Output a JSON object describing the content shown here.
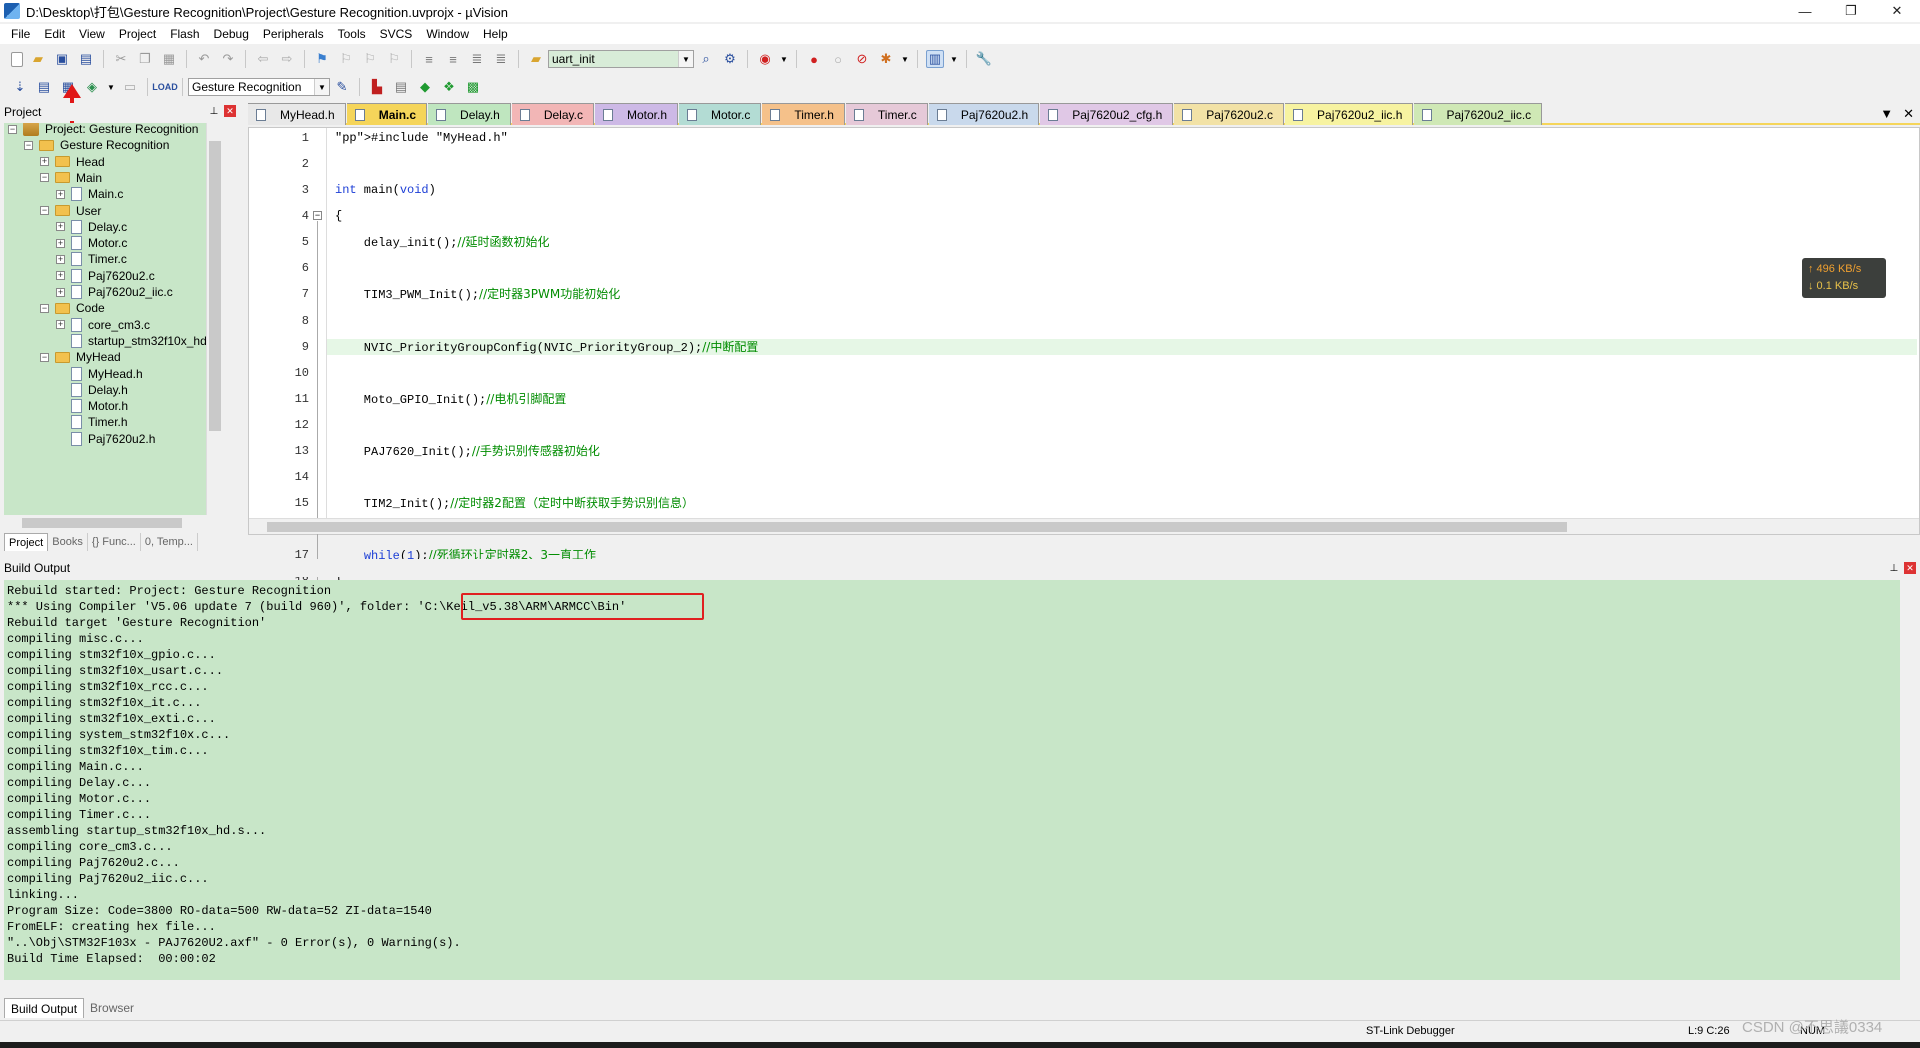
{
  "window": {
    "title": "D:\\Desktop\\打包\\Gesture Recognition\\Project\\Gesture Recognition.uvprojx - µVision",
    "controls": {
      "minimize": "—",
      "maximize": "❐",
      "close": "✕"
    }
  },
  "menu": [
    "File",
    "Edit",
    "View",
    "Project",
    "Flash",
    "Debug",
    "Peripherals",
    "Tools",
    "SVCS",
    "Window",
    "Help"
  ],
  "toolbar": {
    "find_combo": "uart_init",
    "target_combo": "Gesture Recognition"
  },
  "project_panel": {
    "title": "Project",
    "tree": [
      {
        "label": "Project: Gesture Recognition",
        "level": 0,
        "kind": "project",
        "expander": "−"
      },
      {
        "label": "Gesture Recognition",
        "level": 1,
        "kind": "target",
        "expander": "−"
      },
      {
        "label": "Head",
        "level": 2,
        "kind": "folder",
        "expander": "+"
      },
      {
        "label": "Main",
        "level": 2,
        "kind": "folder",
        "expander": "−"
      },
      {
        "label": "Main.c",
        "level": 3,
        "kind": "file",
        "expander": "+"
      },
      {
        "label": "User",
        "level": 2,
        "kind": "folder",
        "expander": "−"
      },
      {
        "label": "Delay.c",
        "level": 3,
        "kind": "file",
        "expander": "+"
      },
      {
        "label": "Motor.c",
        "level": 3,
        "kind": "file",
        "expander": "+"
      },
      {
        "label": "Timer.c",
        "level": 3,
        "kind": "file",
        "expander": "+"
      },
      {
        "label": "Paj7620u2.c",
        "level": 3,
        "kind": "file",
        "expander": "+"
      },
      {
        "label": "Paj7620u2_iic.c",
        "level": 3,
        "kind": "file",
        "expander": "+"
      },
      {
        "label": "Code",
        "level": 2,
        "kind": "folder",
        "expander": "−"
      },
      {
        "label": "core_cm3.c",
        "level": 3,
        "kind": "file",
        "expander": "+"
      },
      {
        "label": "startup_stm32f10x_hd",
        "level": 3,
        "kind": "file",
        "expander": ""
      },
      {
        "label": "MyHead",
        "level": 2,
        "kind": "folder",
        "expander": "−"
      },
      {
        "label": "MyHead.h",
        "level": 3,
        "kind": "file",
        "expander": ""
      },
      {
        "label": "Delay.h",
        "level": 3,
        "kind": "file",
        "expander": ""
      },
      {
        "label": "Motor.h",
        "level": 3,
        "kind": "file",
        "expander": ""
      },
      {
        "label": "Timer.h",
        "level": 3,
        "kind": "file",
        "expander": ""
      },
      {
        "label": "Paj7620u2.h",
        "level": 3,
        "kind": "file",
        "expander": ""
      }
    ],
    "tabs": [
      "Project",
      "Books",
      "{} Func...",
      "0, Temp..."
    ]
  },
  "editor": {
    "tabs": [
      {
        "label": "MyHead.h",
        "color": "#e8e8e8",
        "active": false
      },
      {
        "label": "Main.c",
        "color": "#f5d55a",
        "active": true
      },
      {
        "label": "Delay.h",
        "color": "#bfe6bf",
        "active": false
      },
      {
        "label": "Delay.c",
        "color": "#f2b6b6",
        "active": false
      },
      {
        "label": "Motor.h",
        "color": "#cdb9e6",
        "active": false
      },
      {
        "label": "Motor.c",
        "color": "#b3dcd4",
        "active": false
      },
      {
        "label": "Timer.h",
        "color": "#f5c18a",
        "active": false
      },
      {
        "label": "Timer.c",
        "color": "#e6c9d8",
        "active": false
      },
      {
        "label": "Paj7620u2.h",
        "color": "#c9d9ec",
        "active": false
      },
      {
        "label": "Paj7620u2_cfg.h",
        "color": "#e0c8e6",
        "active": false
      },
      {
        "label": "Paj7620u2.c",
        "color": "#f2e2a6",
        "active": false
      },
      {
        "label": "Paj7620u2_iic.h",
        "color": "#f7f3a1",
        "active": false
      },
      {
        "label": "Paj7620u2_iic.c",
        "color": "#cfe8b5",
        "active": false
      }
    ],
    "current_line": 9,
    "lines": [
      "#include \"MyHead.h\"",
      "",
      "int main(void)",
      "{",
      "    delay_init();//延时函数初始化",
      "",
      "    TIM3_PWM_Init();//定时器3PWM功能初始化",
      "",
      "    NVIC_PriorityGroupConfig(NVIC_PriorityGroup_2);//中断配置",
      "",
      "    Moto_GPIO_Init();//电机引脚配置",
      "",
      "    PAJ7620_Init();//手势识别传感器初始化",
      "",
      "    TIM2_Init();//定时器2配置（定时中断获取手势识别信息）",
      "",
      "    while(1);//死循环让定时器2、3一直工作",
      "}",
      ""
    ]
  },
  "net_widget": {
    "up": "↑ 496 KB/s",
    "down": "↓ 0.1 KB/s"
  },
  "build_output": {
    "title": "Build Output",
    "lines": [
      "Rebuild started: Project: Gesture Recognition",
      "*** Using Compiler 'V5.06 update 7 (build 960)', folder: 'C:\\Keil_v5.38\\ARM\\ARMCC\\Bin'",
      "Rebuild target 'Gesture Recognition'",
      "compiling misc.c...",
      "compiling stm32f10x_gpio.c...",
      "compiling stm32f10x_usart.c...",
      "compiling stm32f10x_rcc.c...",
      "compiling stm32f10x_it.c...",
      "compiling stm32f10x_exti.c...",
      "compiling system_stm32f10x.c...",
      "compiling stm32f10x_tim.c...",
      "compiling Main.c...",
      "compiling Delay.c...",
      "compiling Motor.c...",
      "compiling Timer.c...",
      "assembling startup_stm32f10x_hd.s...",
      "compiling core_cm3.c...",
      "compiling Paj7620u2.c...",
      "compiling Paj7620u2_iic.c...",
      "linking...",
      "Program Size: Code=3800 RO-data=500 RW-data=52 ZI-data=1540",
      "FromELF: creating hex file...",
      "\"..\\Obj\\STM32F103x - PAJ7620U2.axf\" - 0 Error(s), 0 Warning(s).",
      "Build Time Elapsed:  00:00:02"
    ],
    "tabs": [
      "Build Output",
      "Browser"
    ]
  },
  "status": {
    "debugger": "ST-Link Debugger",
    "position": "L:9 C:26",
    "num": "NUM",
    "watermark": "CSDN @不思議0334"
  },
  "colors": {
    "tree_bg": "#c8e6c8",
    "output_bg": "#c8e6c8",
    "annotation_red": "#e01818"
  }
}
